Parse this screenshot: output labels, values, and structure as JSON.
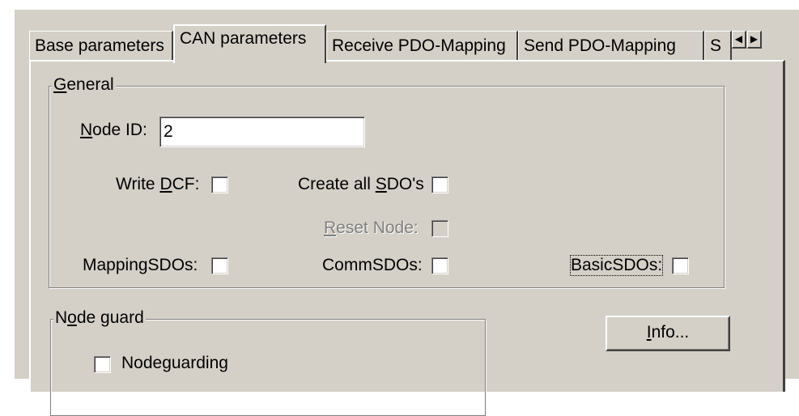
{
  "tabs": [
    {
      "label": "Base parameters",
      "active": false
    },
    {
      "label": "CAN parameters",
      "active": true
    },
    {
      "label": "Receive PDO-Mapping",
      "active": false
    },
    {
      "label": "Send PDO-Mapping",
      "active": false
    },
    {
      "label": "S",
      "active": false
    }
  ],
  "tab_scroll": {
    "left_icon": "arrow-left-icon",
    "right_icon": "arrow-right-icon"
  },
  "general": {
    "title_ul": "G",
    "title_rest": "eneral",
    "node_id": {
      "label_ul": "N",
      "label_rest": "ode ID:",
      "value": "2"
    },
    "write_dcf": {
      "label_pre": "Write ",
      "label_ul": "D",
      "label_rest": "CF:",
      "checked": false
    },
    "create_all_sdos": {
      "label_pre": "Create all ",
      "label_ul": "S",
      "label_rest": "DO's",
      "checked": false
    },
    "reset_node": {
      "label_ul": "R",
      "label_rest": "eset Node:",
      "checked": false,
      "enabled": false
    },
    "mapping_sdos": {
      "label": "MappingSDOs:",
      "checked": false
    },
    "comm_sdos": {
      "label": "CommSDOs:",
      "checked": false
    },
    "basic_sdos": {
      "label": "BasicSDOs:",
      "checked": false
    }
  },
  "node_guard": {
    "title_pre": "N",
    "title_ul": "o",
    "title_rest": "de guard",
    "nodeguarding": {
      "label": "Nodeguarding",
      "checked": false
    }
  },
  "info_button": {
    "label_ul": "I",
    "label_rest": "nfo..."
  }
}
